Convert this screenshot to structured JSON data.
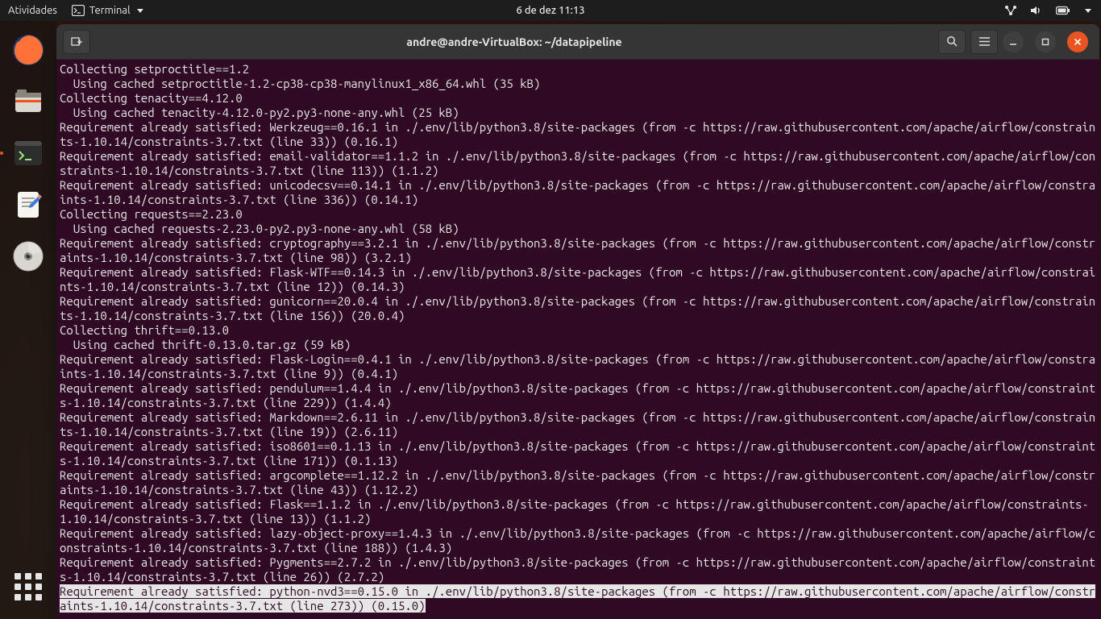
{
  "topbar": {
    "activities": "Atividades",
    "app_name": "Terminal",
    "clock": "6 de dez  11:13"
  },
  "window": {
    "title": "andre@andre-VirtualBox: ~/datapipeline"
  },
  "terminal": {
    "lines": [
      "Collecting setproctitle==1.2",
      "  Using cached setproctitle-1.2-cp38-cp38-manylinux1_x86_64.whl (35 kB)",
      "Collecting tenacity==4.12.0",
      "  Using cached tenacity-4.12.0-py2.py3-none-any.whl (25 kB)",
      "Requirement already satisfied: Werkzeug==0.16.1 in ./.env/lib/python3.8/site-packages (from -c https://raw.githubusercontent.com/apache/airflow/constraints-1.10.14/constraints-3.7.txt (line 33)) (0.16.1)",
      "Requirement already satisfied: email-validator==1.1.2 in ./.env/lib/python3.8/site-packages (from -c https://raw.githubusercontent.com/apache/airflow/constraints-1.10.14/constraints-3.7.txt (line 113)) (1.1.2)",
      "Requirement already satisfied: unicodecsv==0.14.1 in ./.env/lib/python3.8/site-packages (from -c https://raw.githubusercontent.com/apache/airflow/constraints-1.10.14/constraints-3.7.txt (line 336)) (0.14.1)",
      "Collecting requests==2.23.0",
      "  Using cached requests-2.23.0-py2.py3-none-any.whl (58 kB)",
      "Requirement already satisfied: cryptography==3.2.1 in ./.env/lib/python3.8/site-packages (from -c https://raw.githubusercontent.com/apache/airflow/constraints-1.10.14/constraints-3.7.txt (line 98)) (3.2.1)",
      "Requirement already satisfied: Flask-WTF==0.14.3 in ./.env/lib/python3.8/site-packages (from -c https://raw.githubusercontent.com/apache/airflow/constraints-1.10.14/constraints-3.7.txt (line 12)) (0.14.3)",
      "Requirement already satisfied: gunicorn==20.0.4 in ./.env/lib/python3.8/site-packages (from -c https://raw.githubusercontent.com/apache/airflow/constraints-1.10.14/constraints-3.7.txt (line 156)) (20.0.4)",
      "Collecting thrift==0.13.0",
      "  Using cached thrift-0.13.0.tar.gz (59 kB)",
      "Requirement already satisfied: Flask-Login==0.4.1 in ./.env/lib/python3.8/site-packages (from -c https://raw.githubusercontent.com/apache/airflow/constraints-1.10.14/constraints-3.7.txt (line 9)) (0.4.1)",
      "Requirement already satisfied: pendulum==1.4.4 in ./.env/lib/python3.8/site-packages (from -c https://raw.githubusercontent.com/apache/airflow/constraints-1.10.14/constraints-3.7.txt (line 229)) (1.4.4)",
      "Requirement already satisfied: Markdown==2.6.11 in ./.env/lib/python3.8/site-packages (from -c https://raw.githubusercontent.com/apache/airflow/constraints-1.10.14/constraints-3.7.txt (line 19)) (2.6.11)",
      "Requirement already satisfied: iso8601==0.1.13 in ./.env/lib/python3.8/site-packages (from -c https://raw.githubusercontent.com/apache/airflow/constraints-1.10.14/constraints-3.7.txt (line 171)) (0.1.13)",
      "Requirement already satisfied: argcomplete==1.12.2 in ./.env/lib/python3.8/site-packages (from -c https://raw.githubusercontent.com/apache/airflow/constraints-1.10.14/constraints-3.7.txt (line 43)) (1.12.2)",
      "Requirement already satisfied: Flask==1.1.2 in ./.env/lib/python3.8/site-packages (from -c https://raw.githubusercontent.com/apache/airflow/constraints-1.10.14/constraints-3.7.txt (line 13)) (1.1.2)",
      "Requirement already satisfied: lazy-object-proxy==1.4.3 in ./.env/lib/python3.8/site-packages (from -c https://raw.githubusercontent.com/apache/airflow/constraints-1.10.14/constraints-3.7.txt (line 188)) (1.4.3)",
      "Requirement already satisfied: Pygments==2.7.2 in ./.env/lib/python3.8/site-packages (from -c https://raw.githubusercontent.com/apache/airflow/constraints-1.10.14/constraints-3.7.txt (line 26)) (2.7.2)"
    ],
    "highlight": "Requirement already satisfied: python-nvd3==0.15.0 in ./.env/lib/python3.8/site-packages (from -c https://raw.githubusercontent.com/apache/airflow/constraints-1.10.14/constraints-3.7.txt (line 273)) (0.15.0)"
  }
}
